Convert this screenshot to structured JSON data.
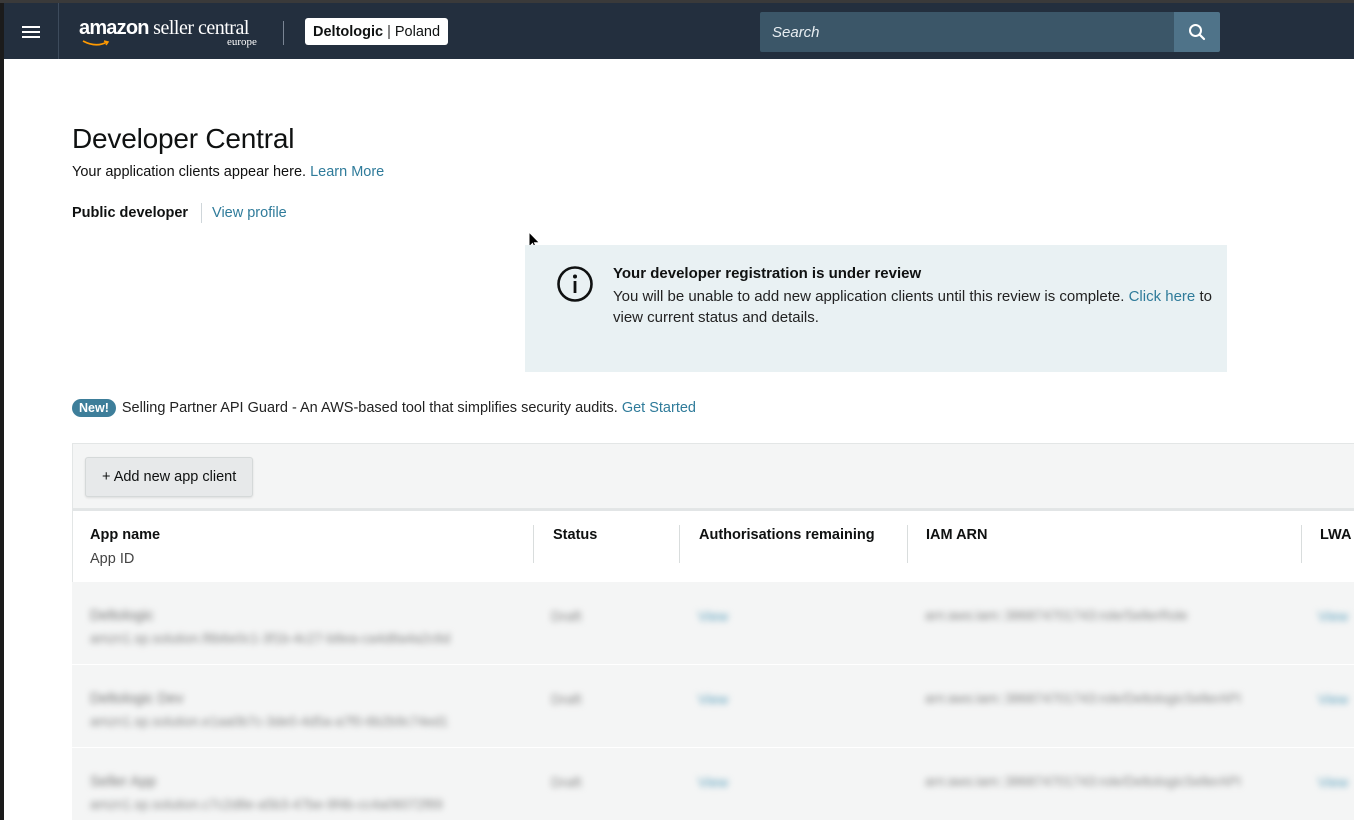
{
  "topbar": {
    "menu_icon": "hamburger-menu-icon",
    "logo": {
      "brand_bold": "amazon",
      "brand_rest": " seller central",
      "region": "europe"
    },
    "account": {
      "name": "Deltologic",
      "separator": "|",
      "marketplace": "Poland"
    },
    "search": {
      "placeholder": "Search",
      "icon": "search-icon"
    }
  },
  "page": {
    "title": "Developer Central",
    "subtitle": "Your application clients appear here.",
    "learn_more": "Learn More",
    "developer_type": "Public developer",
    "view_profile": "View profile"
  },
  "alert": {
    "icon": "info-icon",
    "title": "Your developer registration is under review",
    "body_prefix": "You will be unable to add new application clients until this review is complete.",
    "link": "Click here",
    "body_suffix": "to view current status and details."
  },
  "promo": {
    "badge": "New!",
    "text": "Selling Partner API Guard - An AWS-based tool that simplifies security audits.",
    "link": "Get Started"
  },
  "table": {
    "add_button": "+ Add new app client",
    "columns": [
      {
        "label": "App name",
        "sublabel": "App ID"
      },
      {
        "label": "Status"
      },
      {
        "label": "Authorisations remaining"
      },
      {
        "label": "IAM ARN"
      },
      {
        "label": "LWA"
      }
    ],
    "rows": [
      {
        "name": "Deltologic",
        "app_id": "amzn1.sp.solution.f8b6e0c1-3f1b-4c27-b8ea-ca4d8a4a2c6d",
        "status": "Draft",
        "auth": "View",
        "iam": "arn:aws:iam::386874701743:role/SellerRole",
        "lwa": "View"
      },
      {
        "name": "Deltologic Dev",
        "app_id": "amzn1.sp.solution.e1aa0b7c-3de0-4d5a-a7f0-6b2b9c74ed1",
        "status": "Draft",
        "auth": "View",
        "iam": "arn:aws:iam::386874701743:role/DeltologicSellerAPI",
        "lwa": "View"
      },
      {
        "name": "Seller App",
        "app_id": "amzn1.sp.solution.c7c2d8e-a5b3-47be-9f4b-cc4a06072f89",
        "status": "Draft",
        "auth": "View",
        "iam": "arn:aws:iam::386874701743:role/DeltologicSellerAPI",
        "lwa": "View"
      }
    ]
  }
}
